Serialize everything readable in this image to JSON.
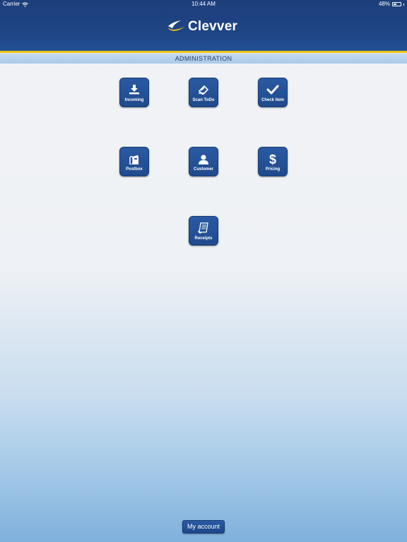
{
  "status_bar": {
    "carrier": "Carrier",
    "time": "10:44 AM",
    "battery": "48%",
    "battery_level": 0.48,
    "wifi_icon": "wifi-icon",
    "battery_icon": "battery-icon"
  },
  "header": {
    "brand": "Clevver",
    "logo_icon": "swoosh-logo-icon"
  },
  "section": {
    "title": "ADMINISTRATION"
  },
  "tiles": [
    {
      "label": "Incoming",
      "icon": "download-icon"
    },
    {
      "label": "Scan ToDo",
      "icon": "scan-icon"
    },
    {
      "label": "Check Item",
      "icon": "checkmark-icon"
    },
    {
      "label": "Postbox",
      "icon": "mailbox-icon"
    },
    {
      "label": "Customer",
      "icon": "person-icon"
    },
    {
      "label": "Pricing",
      "icon": "dollar-icon"
    },
    {
      "label": "Receipts",
      "icon": "receipt-icon"
    }
  ],
  "footer": {
    "account_label": "My account"
  },
  "colors": {
    "header_blue": "#1e4484",
    "accent_yellow": "#f2c318",
    "tile_blue": "#2a5aa3",
    "section_text": "#1e3b6e"
  }
}
